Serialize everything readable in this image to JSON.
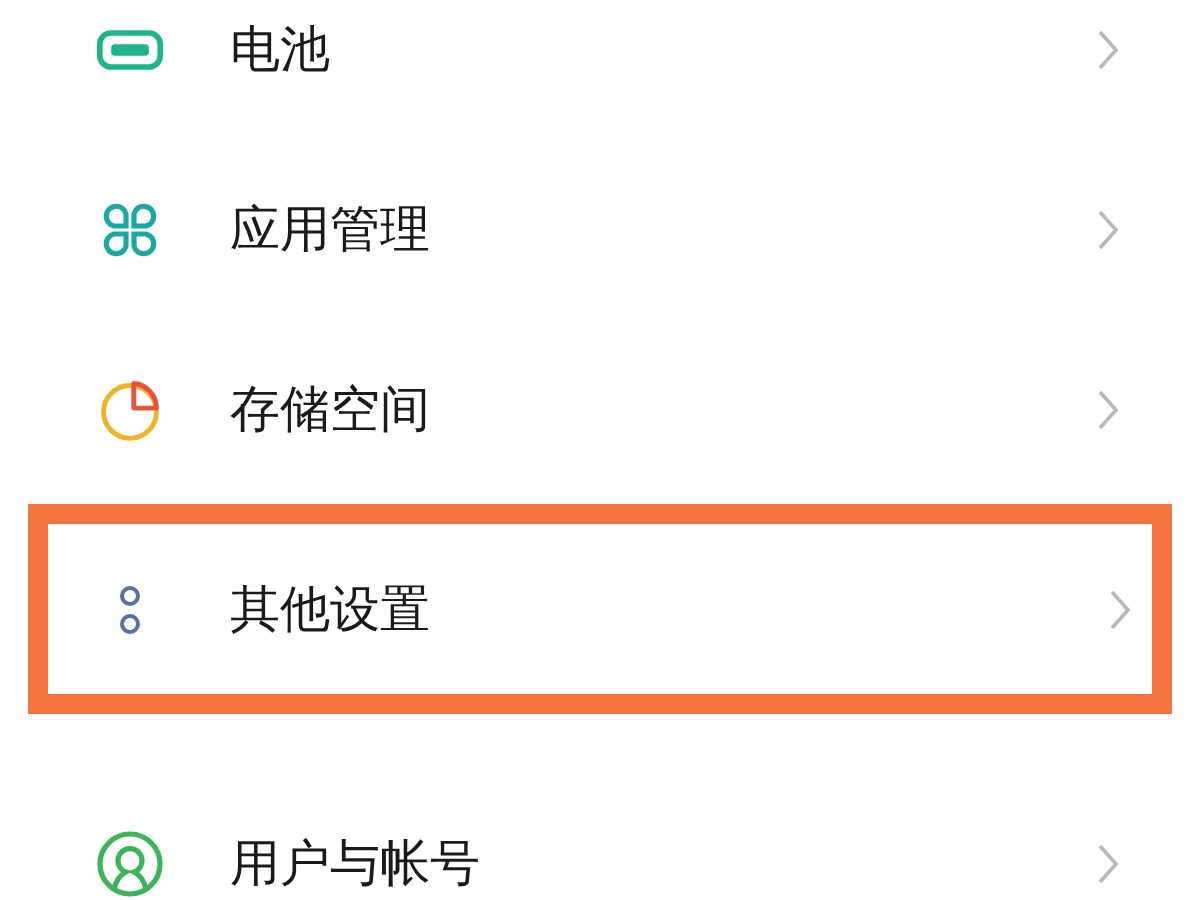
{
  "settings_items": [
    {
      "kind": "battery",
      "label": "电池",
      "highlighted": false
    },
    {
      "kind": "apps",
      "label": "应用管理",
      "highlighted": false
    },
    {
      "kind": "storage",
      "label": "存储空间",
      "highlighted": false
    },
    {
      "kind": "more",
      "label": "其他设置",
      "highlighted": true
    },
    {
      "kind": "users",
      "label": "用户与帐号",
      "highlighted": false,
      "section_start": true
    }
  ]
}
